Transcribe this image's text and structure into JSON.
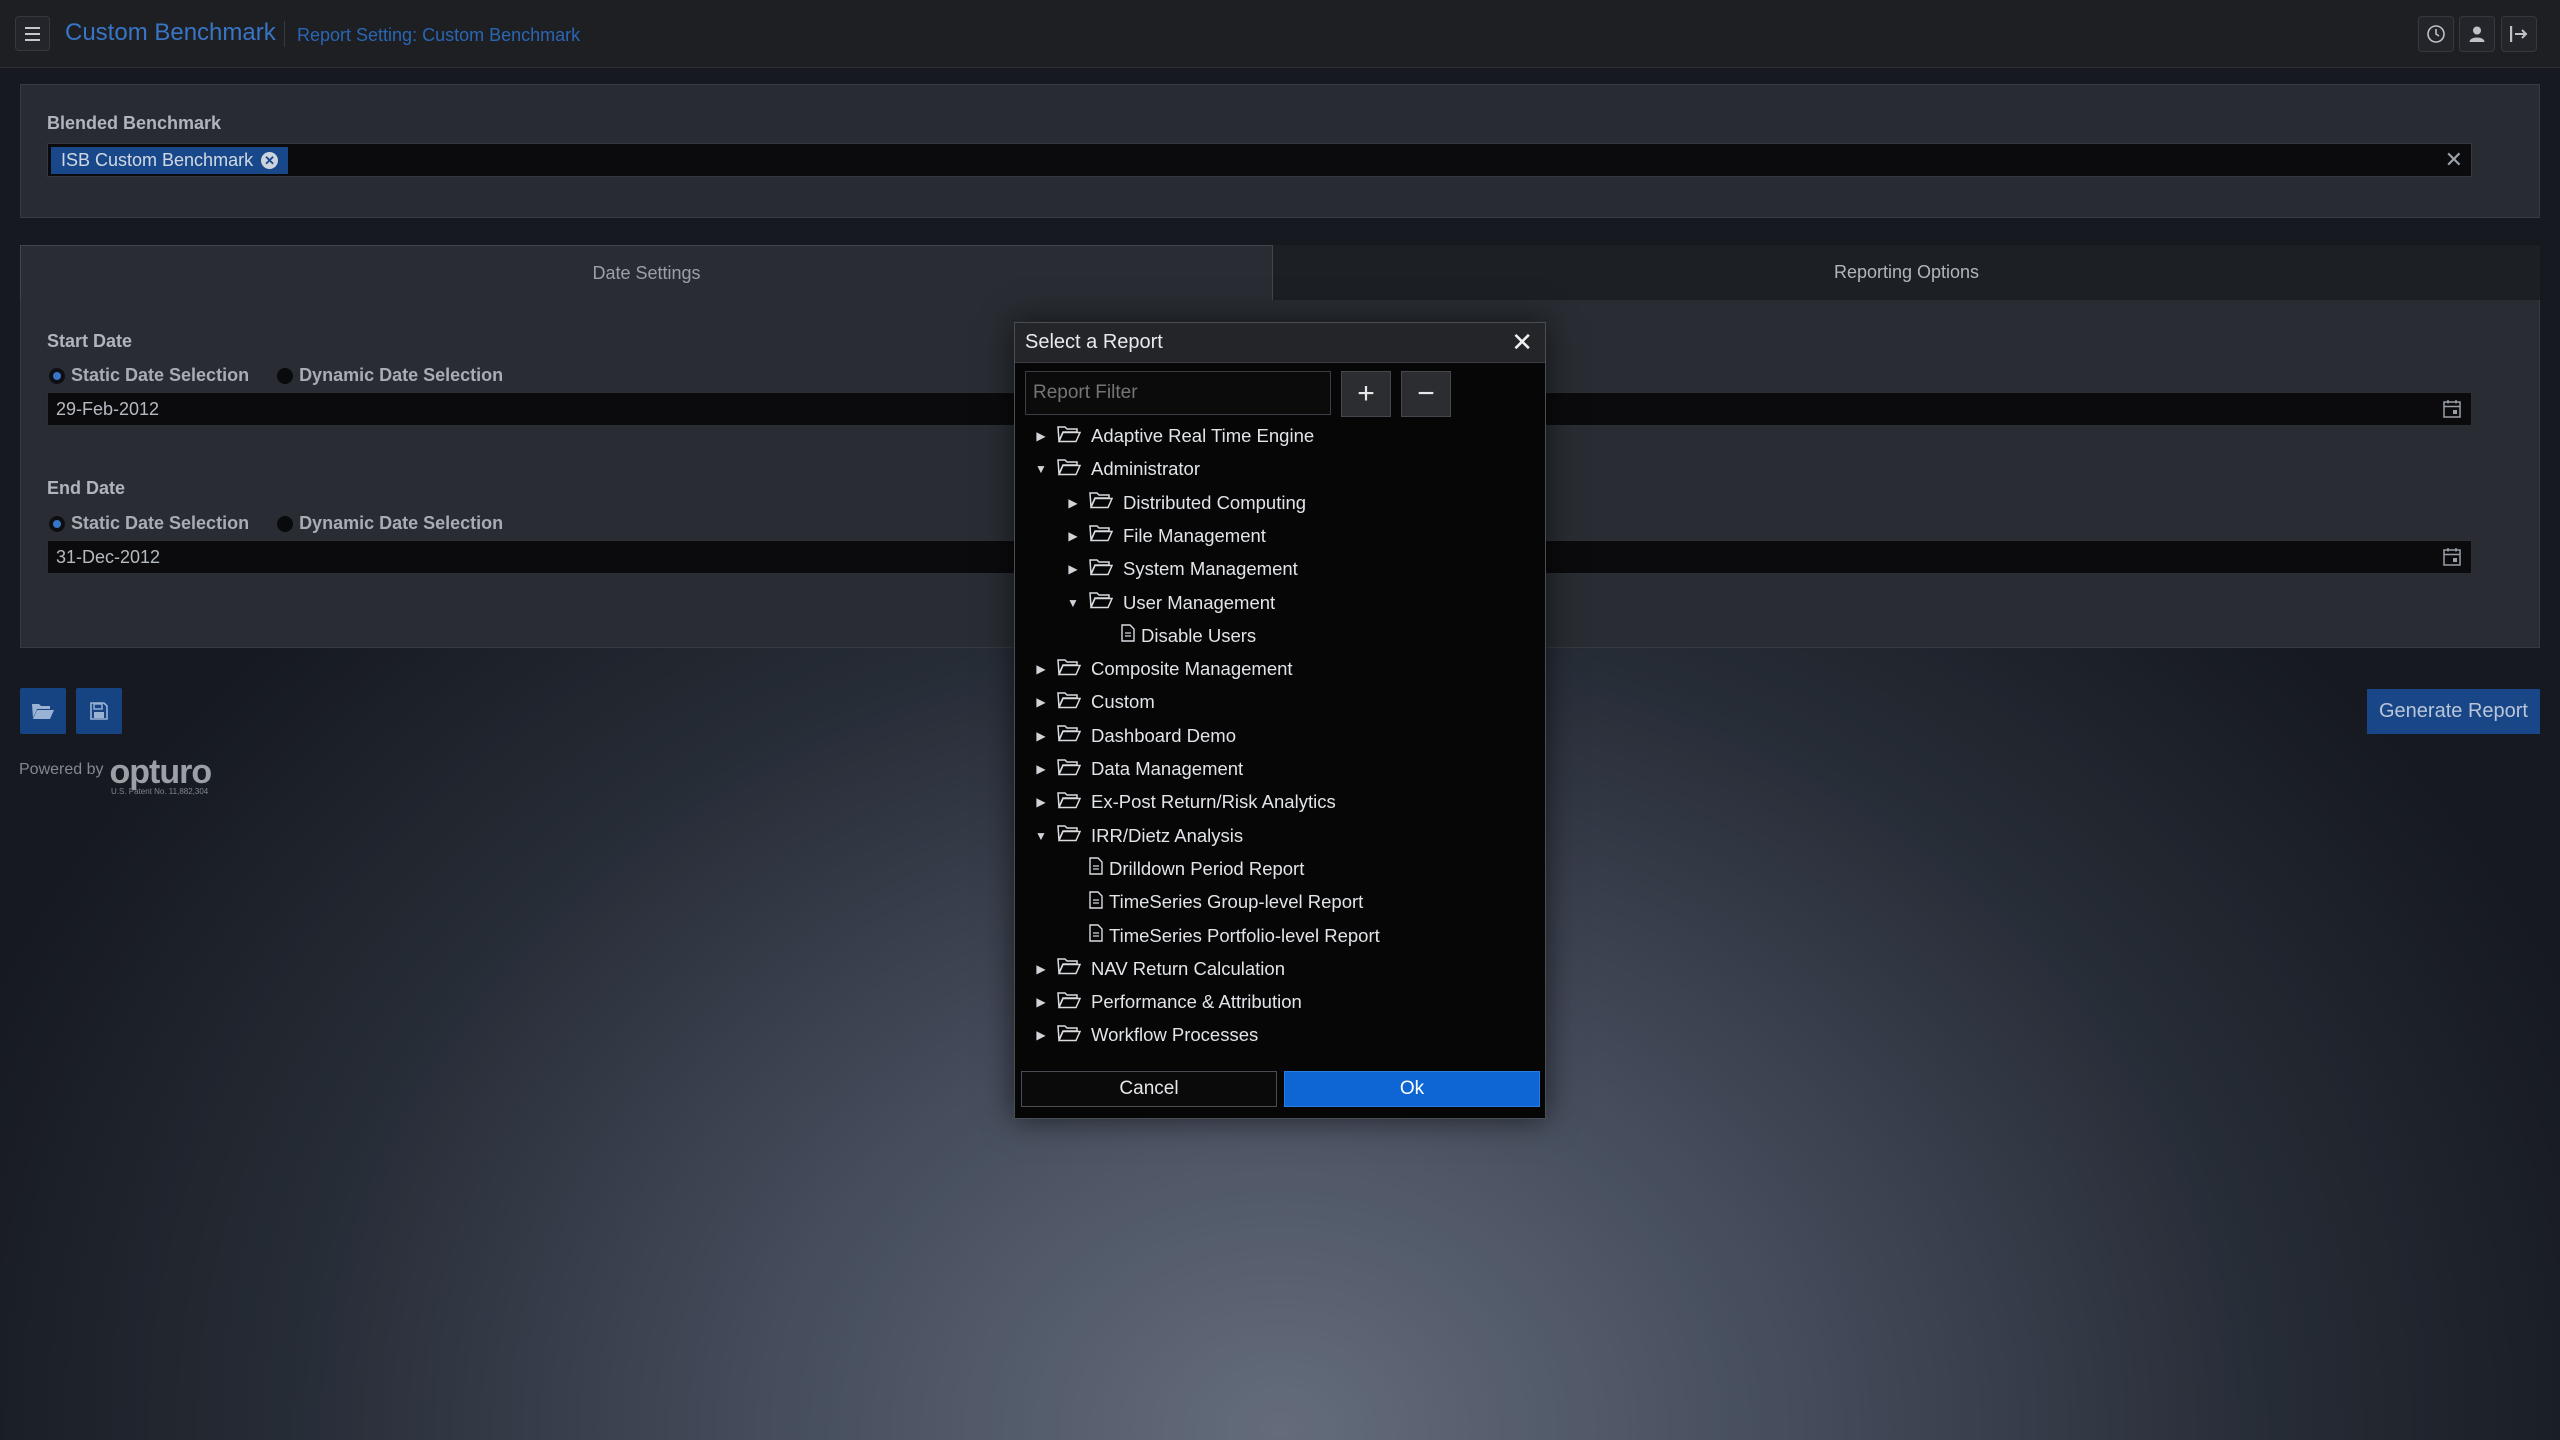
{
  "header": {
    "app_title": "Custom Benchmark",
    "page_subtitle": "Report Setting: Custom Benchmark",
    "icons": [
      "menu-icon",
      "clock-icon",
      "user-icon",
      "logout-icon"
    ]
  },
  "blended": {
    "label": "Blended Benchmark",
    "chip": "ISB Custom Benchmark",
    "chip_remove": "✕",
    "clear": "✕"
  },
  "tabs": {
    "date_settings": "Date Settings",
    "reporting_options": "Reporting Options"
  },
  "dates": {
    "start_label": "Start Date",
    "end_label": "End Date",
    "static_label": "Static Date Selection",
    "dynamic_label": "Dynamic Date Selection",
    "start_value": "29-Feb-2012",
    "end_value": "31-Dec-2012"
  },
  "actions": {
    "generate": "Generate Report"
  },
  "branding": {
    "powered_by": "Powered by",
    "brand": "opturo",
    "patent": "U.S. Patent No. 11,882,304"
  },
  "modal": {
    "title": "Select a Report",
    "close": "✕",
    "filter_placeholder": "Report Filter",
    "expand_all": "+",
    "collapse_all": "−",
    "cancel": "Cancel",
    "ok": "Ok",
    "tree": [
      {
        "label": "Adaptive Real Time Engine",
        "type": "folder",
        "level": 0,
        "expanded": false
      },
      {
        "label": "Administrator",
        "type": "folder",
        "level": 0,
        "expanded": true
      },
      {
        "label": "Distributed Computing",
        "type": "folder",
        "level": 1,
        "expanded": false
      },
      {
        "label": "File Management",
        "type": "folder",
        "level": 1,
        "expanded": false
      },
      {
        "label": "System Management",
        "type": "folder",
        "level": 1,
        "expanded": false
      },
      {
        "label": "User Management",
        "type": "folder",
        "level": 1,
        "expanded": true
      },
      {
        "label": "Disable Users",
        "type": "report",
        "level": 2
      },
      {
        "label": "Composite Management",
        "type": "folder",
        "level": 0,
        "expanded": false
      },
      {
        "label": "Custom",
        "type": "folder",
        "level": 0,
        "expanded": false
      },
      {
        "label": "Dashboard Demo",
        "type": "folder",
        "level": 0,
        "expanded": false
      },
      {
        "label": "Data Management",
        "type": "folder",
        "level": 0,
        "expanded": false
      },
      {
        "label": "Ex-Post Return/Risk Analytics",
        "type": "folder",
        "level": 0,
        "expanded": false
      },
      {
        "label": "IRR/Dietz Analysis",
        "type": "folder",
        "level": 0,
        "expanded": true
      },
      {
        "label": "Drilldown Period Report",
        "type": "report",
        "level": 1
      },
      {
        "label": "TimeSeries Group-level Report",
        "type": "report",
        "level": 1
      },
      {
        "label": "TimeSeries Portfolio-level Report",
        "type": "report",
        "level": 1
      },
      {
        "label": "NAV Return Calculation",
        "type": "folder",
        "level": 0,
        "expanded": false
      },
      {
        "label": "Performance & Attribution",
        "type": "folder",
        "level": 0,
        "expanded": false
      },
      {
        "label": "Workflow Processes",
        "type": "folder",
        "level": 0,
        "expanded": false
      }
    ]
  },
  "colors": {
    "accent": "#3e7fd6",
    "primary_button": "#0e66d4",
    "chip": "#1b4f96",
    "toolbar_button": "#184a8f"
  }
}
